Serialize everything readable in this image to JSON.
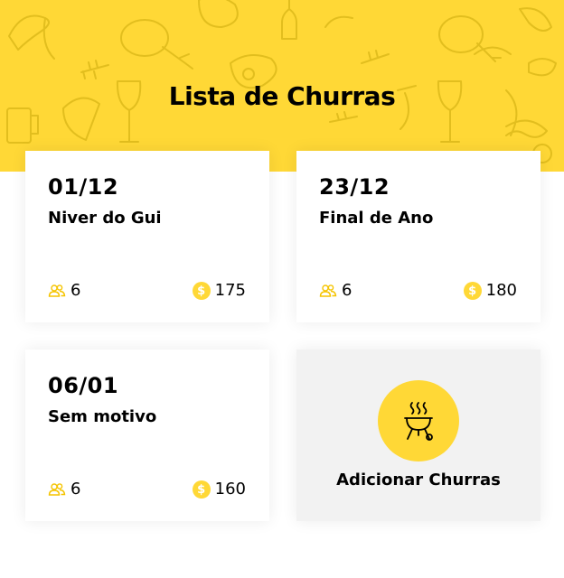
{
  "page": {
    "title": "Lista de Churras"
  },
  "colors": {
    "accent": "#FFD836",
    "card_bg": "#FFFFFF",
    "add_card_bg": "#F2F2F2",
    "text": "#000000"
  },
  "churras": [
    {
      "date": "01/12",
      "title": "Niver do Gui",
      "people": "6",
      "amount": "175"
    },
    {
      "date": "23/12",
      "title": "Final de Ano",
      "people": "6",
      "amount": "180"
    },
    {
      "date": "06/01",
      "title": "Sem motivo",
      "people": "6",
      "amount": "160"
    }
  ],
  "add": {
    "label": "Adicionar Churras",
    "icon": "grill-icon"
  },
  "icons": {
    "people": "people-icon",
    "money": "dollar-coin-icon",
    "money_glyph": "$",
    "background": "bbq-doodle-pattern"
  }
}
